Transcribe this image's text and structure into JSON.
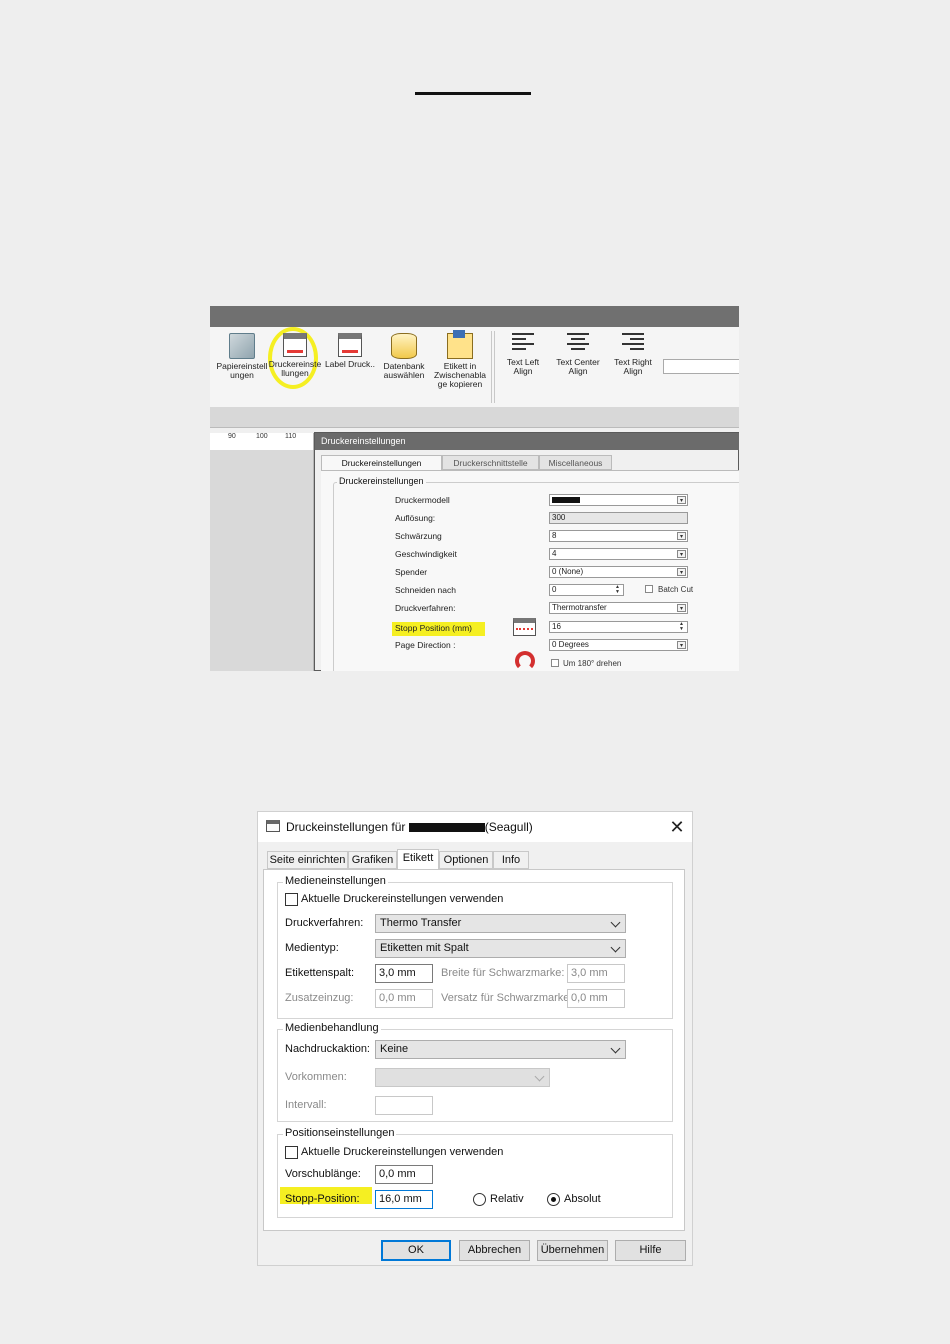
{
  "toolbar": {
    "buttons": [
      {
        "line1": "Papiereinstell",
        "line2": "ungen",
        "line3": ""
      },
      {
        "line1": "Druckereinste",
        "line2": "llungen",
        "line3": ""
      },
      {
        "line1": "Label Druck..",
        "line2": "",
        "line3": ""
      },
      {
        "line1": "Datenbank",
        "line2": "auswählen",
        "line3": ""
      },
      {
        "line1": "Etikett in",
        "line2": "Zwischenabla",
        "line3": "ge kopieren"
      },
      {
        "line1": "Text Left",
        "line2": "Align",
        "line3": ""
      },
      {
        "line1": "Text Center",
        "line2": "Align",
        "line3": ""
      },
      {
        "line1": "Text Right",
        "line2": "Align",
        "line3": ""
      }
    ]
  },
  "ruler": {
    "ticks": [
      "90",
      "100",
      "110"
    ]
  },
  "dialog1": {
    "title": "Druckereinstellungen",
    "tabs": [
      "Druckereinstellungen",
      "Druckerschnittstelle",
      "Miscellaneous"
    ],
    "group_title": "Druckereinstellungen",
    "fields": [
      {
        "label": "Druckermodell",
        "value": ""
      },
      {
        "label": "Auflösung:",
        "value": "300"
      },
      {
        "label": "Schwärzung",
        "value": "8"
      },
      {
        "label": "Geschwindigkeit",
        "value": "4"
      },
      {
        "label": "Spender",
        "value": "0 (None)"
      },
      {
        "label": "Schneiden nach",
        "value": "0"
      },
      {
        "label": "Druckverfahren:",
        "value": "Thermotransfer"
      },
      {
        "label": "Stopp Position (mm)",
        "value": "16"
      },
      {
        "label": "Page Direction :",
        "value": "0 Degrees"
      }
    ],
    "batch_cut_label": "Batch Cut",
    "rotate_label": "Um 180° drehen"
  },
  "dialog2": {
    "title_prefix": "Druckeinstellungen für",
    "title_suffix": "(Seagull)",
    "close_symbol": "✕",
    "tabs": [
      "Seite einrichten",
      "Grafiken",
      "Etikett",
      "Optionen",
      "Info"
    ],
    "media": {
      "legend": "Medieneinstellungen",
      "use_current_label": "Aktuelle Druckereinstellungen verwenden",
      "druckverfahren_label": "Druckverfahren:",
      "druckverfahren_value": "Thermo Transfer",
      "medientyp_label": "Medientyp:",
      "medientyp_value": "Etiketten mit Spalt",
      "etikettenspalt_label": "Etikettenspalt:",
      "etikettenspalt_value": "3,0 mm",
      "breite_label": "Breite für Schwarzmarke:",
      "breite_value": "3,0 mm",
      "zusatzeinzug_label": "Zusatzeinzug:",
      "zusatzeinzug_value": "0,0 mm",
      "versatz_label": "Versatz für Schwarzmarke:",
      "versatz_value": "0,0 mm"
    },
    "handling": {
      "legend": "Medienbehandlung",
      "nachdruck_label": "Nachdruckaktion:",
      "nachdruck_value": "Keine",
      "vorkommen_label": "Vorkommen:",
      "intervall_label": "Intervall:"
    },
    "position": {
      "legend": "Positionseinstellungen",
      "use_current_label": "Aktuelle Druckereinstellungen verwenden",
      "vorschub_label": "Vorschublänge:",
      "vorschub_value": "0,0 mm",
      "stopp_label": "Stopp-Position:",
      "stopp_value": "16,0 mm",
      "relativ_label": "Relativ",
      "absolut_label": "Absolut"
    },
    "buttons": {
      "ok": "OK",
      "abbrechen": "Abbrechen",
      "uebernehmen": "Übernehmen",
      "hilfe": "Hilfe"
    }
  },
  "colors": {
    "highlight": "#f5ef22",
    "focus": "#0078d7"
  }
}
